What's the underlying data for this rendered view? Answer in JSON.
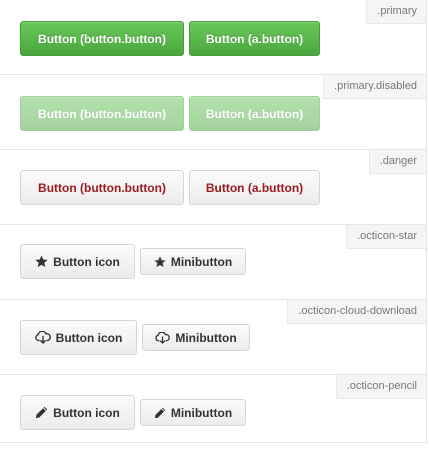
{
  "sections": [
    {
      "tag": ".primary",
      "buttons": [
        "Button (button.button)",
        "Button (a.button)"
      ]
    },
    {
      "tag": ".primary.disabled",
      "buttons": [
        "Button (button.button)",
        "Button (a.button)"
      ]
    },
    {
      "tag": ".danger",
      "buttons": [
        "Button (button.button)",
        "Button (a.button)"
      ]
    },
    {
      "tag": ".octicon-star",
      "icon": "star-icon",
      "buttons": [
        "Button icon",
        "Minibutton"
      ]
    },
    {
      "tag": ".octicon-cloud-download",
      "icon": "cloud-download-icon",
      "buttons": [
        "Button icon",
        "Minibutton"
      ]
    },
    {
      "tag": ".octicon-pencil",
      "icon": "pencil-icon",
      "buttons": [
        "Button icon",
        "Minibutton"
      ]
    }
  ],
  "colors": {
    "primary": "#4aa63e",
    "danger_text": "#9c1a1c",
    "neutral_text": "#333333",
    "tag_background": "#f5f5f5"
  }
}
